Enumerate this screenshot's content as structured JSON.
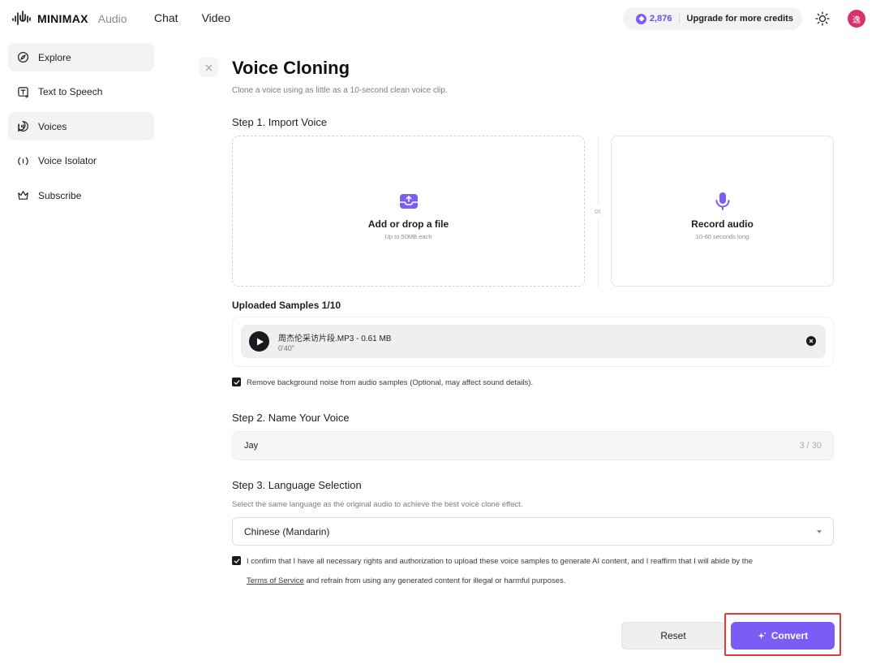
{
  "header": {
    "brand": "MINIMAX",
    "product": "Audio",
    "nav": [
      "Chat",
      "Video"
    ],
    "credits": "2,876",
    "upgrade_label": "Upgrade for more credits",
    "avatar_text": "逸"
  },
  "sidebar": {
    "items": [
      {
        "label": "Explore",
        "icon": "compass-icon",
        "active": false
      },
      {
        "label": "Text to Speech",
        "icon": "text-to-speech-icon",
        "active": false
      },
      {
        "label": "Voices",
        "icon": "voices-icon",
        "active": true
      },
      {
        "label": "Voice Isolator",
        "icon": "voice-isolator-icon",
        "active": false
      },
      {
        "label": "Subscribe",
        "icon": "crown-icon",
        "active": false
      }
    ]
  },
  "page": {
    "title": "Voice Cloning",
    "subtitle": "Clone a voice using as little as a 10-second clean voice clip."
  },
  "step1": {
    "title": "Step 1. Import Voice",
    "upload_title": "Add or drop a file",
    "upload_sub": "Up to 50MB each",
    "or_label": "or",
    "record_title": "Record audio",
    "record_sub": "10-60 seconds long"
  },
  "samples": {
    "title": "Uploaded Samples  1/10",
    "items": [
      {
        "name": "周杰伦采访片段.MP3 - 0.61 MB",
        "duration": "0'40\""
      }
    ],
    "noise_label": "Remove background noise from audio samples (Optional, may affect sound details).",
    "noise_checked": true
  },
  "step2": {
    "title": "Step 2. Name Your Voice",
    "value": "Jay",
    "counter": "3 / 30"
  },
  "step3": {
    "title": "Step 3. Language Selection",
    "description": "Select the same language as the original audio to achieve the best voice clone effect.",
    "selected": "Chinese (Mandarin)"
  },
  "consent": {
    "line1": "I confirm that I have all necessary rights and authorization to upload these voice samples to generate AI content, and I reaffirm that I will abide by the",
    "tos_link": "Terms of Service",
    "line2_rest": " and refrain from using any generated content for illegal or harmful purposes.",
    "checked": true
  },
  "actions": {
    "reset_label": "Reset",
    "convert_label": "Convert"
  },
  "colors": {
    "accent": "#7b5cf5",
    "highlight": "#e53935",
    "avatar": "#d6336c"
  }
}
